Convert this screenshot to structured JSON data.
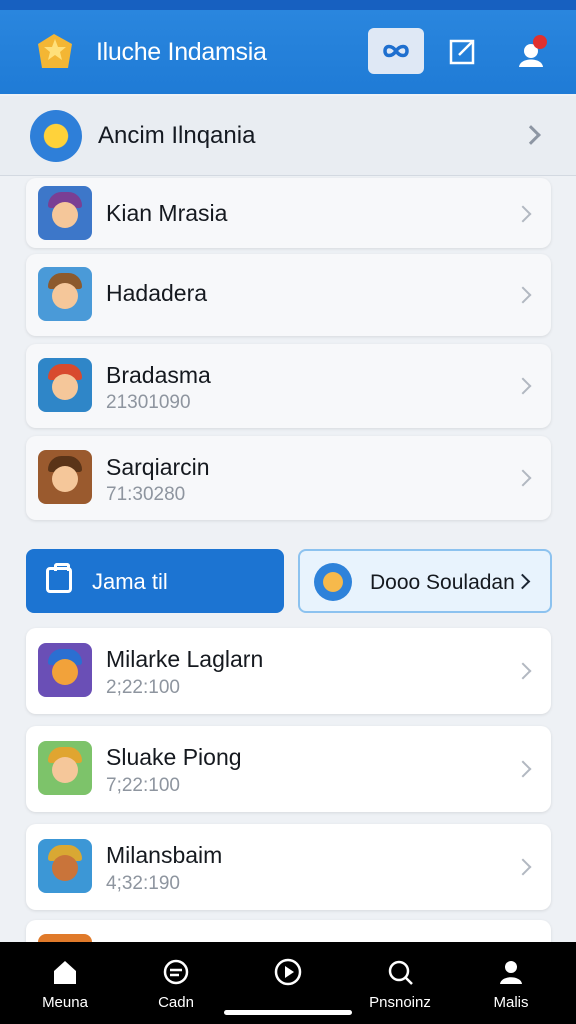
{
  "header": {
    "title": "Iluche Indamsia",
    "logo_icon": "star-folder-logo",
    "buttons": [
      {
        "name": "link-button",
        "icon": "infinity-link-icon"
      },
      {
        "name": "edit-button",
        "icon": "edit-icon"
      },
      {
        "name": "profile-button",
        "icon": "user-alert-icon"
      }
    ]
  },
  "section": {
    "title": "Ancim Ilnqania",
    "icon": "badge-icon"
  },
  "list_top": [
    {
      "name": "Kian Mrasia",
      "sub": ""
    },
    {
      "name": "Hadadera",
      "sub": ""
    },
    {
      "name": "Bradasma",
      "sub": "21301090"
    },
    {
      "name": "Sarqiarcin",
      "sub": "71:30280"
    }
  ],
  "actions": {
    "primary_label": "Jama til",
    "secondary_label": "Dooo Souladan"
  },
  "list_bottom": [
    {
      "name": "Milarke Laglarn",
      "sub": "2;22:100"
    },
    {
      "name": "Sluake Piong",
      "sub": "7;22:100"
    },
    {
      "name": "Milansbaim",
      "sub": "4;32:190"
    }
  ],
  "bottom_nav": [
    {
      "label": "Meuna",
      "icon": "home-icon"
    },
    {
      "label": "Cadn",
      "icon": "chat-icon"
    },
    {
      "label": "",
      "icon": "play-icon"
    },
    {
      "label": "Pnsnoinz",
      "icon": "search-icon"
    },
    {
      "label": "Malis",
      "icon": "person-icon"
    }
  ],
  "colors": {
    "header": "#1f7bd6",
    "accent": "#1c74d2",
    "nav": "#000000"
  }
}
